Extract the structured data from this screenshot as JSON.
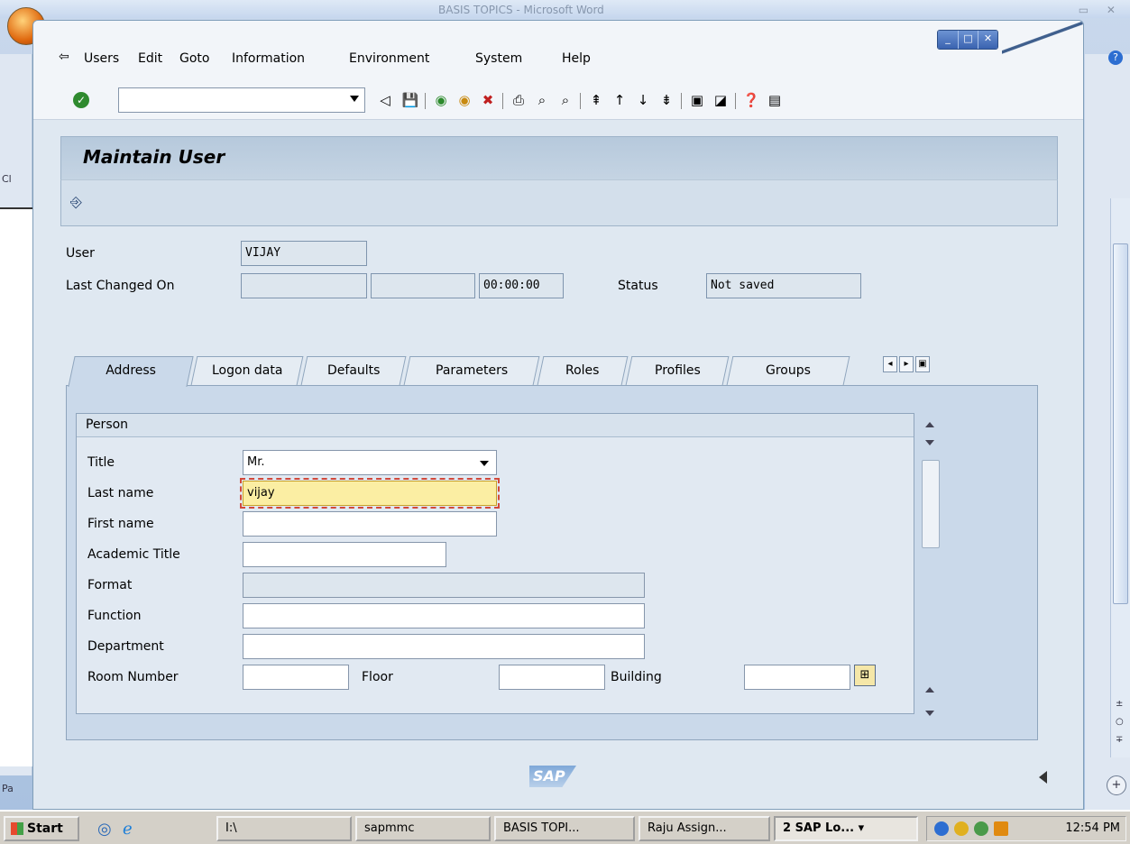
{
  "background": {
    "word_title": "BASIS TOPICS - Microsoft Word",
    "left_labels": [
      "Cl",
      "Pa"
    ]
  },
  "menu": {
    "items": [
      "Users",
      "Edit",
      "Goto",
      "Information",
      "Environment",
      "System",
      "Help"
    ]
  },
  "toolbar": {
    "command_value": ""
  },
  "page": {
    "title": "Maintain User"
  },
  "header_fields": {
    "user_label": "User",
    "user_value": "VIJAY",
    "last_changed_label": "Last Changed On",
    "last_changed_date": "",
    "last_changed_by": "",
    "last_changed_time": "00:00:00",
    "status_label": "Status",
    "status_value": "Not saved"
  },
  "tabs": [
    {
      "label": "Address",
      "active": true
    },
    {
      "label": "Logon data"
    },
    {
      "label": "Defaults"
    },
    {
      "label": "Parameters"
    },
    {
      "label": "Roles"
    },
    {
      "label": "Profiles"
    },
    {
      "label": "Groups"
    }
  ],
  "person": {
    "group_title": "Person",
    "title_label": "Title",
    "title_value": "Mr.",
    "last_name_label": "Last name",
    "last_name_value": "vijay",
    "first_name_label": "First name",
    "first_name_value": "",
    "academic_title_label": "Academic Title",
    "academic_title_value": "",
    "format_label": "Format",
    "format_value": "",
    "function_label": "Function",
    "function_value": "",
    "department_label": "Department",
    "department_value": "",
    "room_label": "Room Number",
    "room_value": "",
    "floor_label": "Floor",
    "floor_value": "",
    "building_label": "Building",
    "building_value": ""
  },
  "statusbar": {
    "logo": "SAP"
  },
  "taskbar": {
    "start": "Start",
    "tasks": [
      "I:\\",
      "sapmmc",
      "BASIS TOPI...",
      "Raju Assign...",
      "2 SAP Lo..."
    ],
    "clock": "12:54 PM"
  }
}
